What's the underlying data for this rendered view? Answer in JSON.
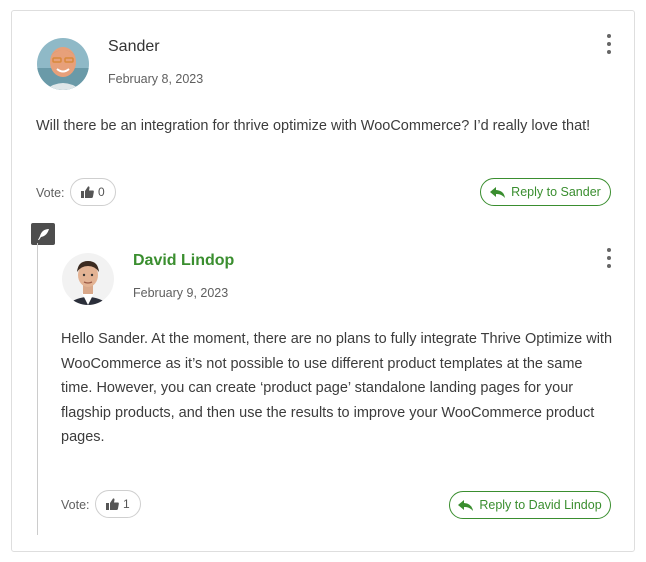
{
  "comment": {
    "author": "Sander",
    "date": "February 8, 2023",
    "text": "Will there be an integration for thrive optimize with WooCommerce? I’d really love that!",
    "vote_label": "Vote:",
    "vote_count": "0",
    "reply_label": "Reply to Sander"
  },
  "reply": {
    "author": "David Lindop",
    "date": "February 9, 2023",
    "text_lines": [
      "Hello Sander. At the moment, there are no plans to fully integrate Thrive Optimize with",
      "WooCommerce as it’s not possible to use different product templates at the same",
      "time. However, you can create ‘product page’ standalone landing pages for your",
      "flagship products, and then use the results to improve your WooCommerce product",
      "pages."
    ],
    "vote_label": "Vote:",
    "vote_count": "1",
    "reply_label": "Reply to David Lindop"
  },
  "icons": {
    "menu": "kebab-menu-icon",
    "thumb": "thumbs-up-icon",
    "reply": "reply-arrow-icon",
    "thread": "feather-icon"
  },
  "colors": {
    "accent": "#3a8e2f",
    "border": "#dedede",
    "text": "#3c3c3c",
    "muted": "#5f5f5f",
    "badge": "#4d4d4d"
  }
}
